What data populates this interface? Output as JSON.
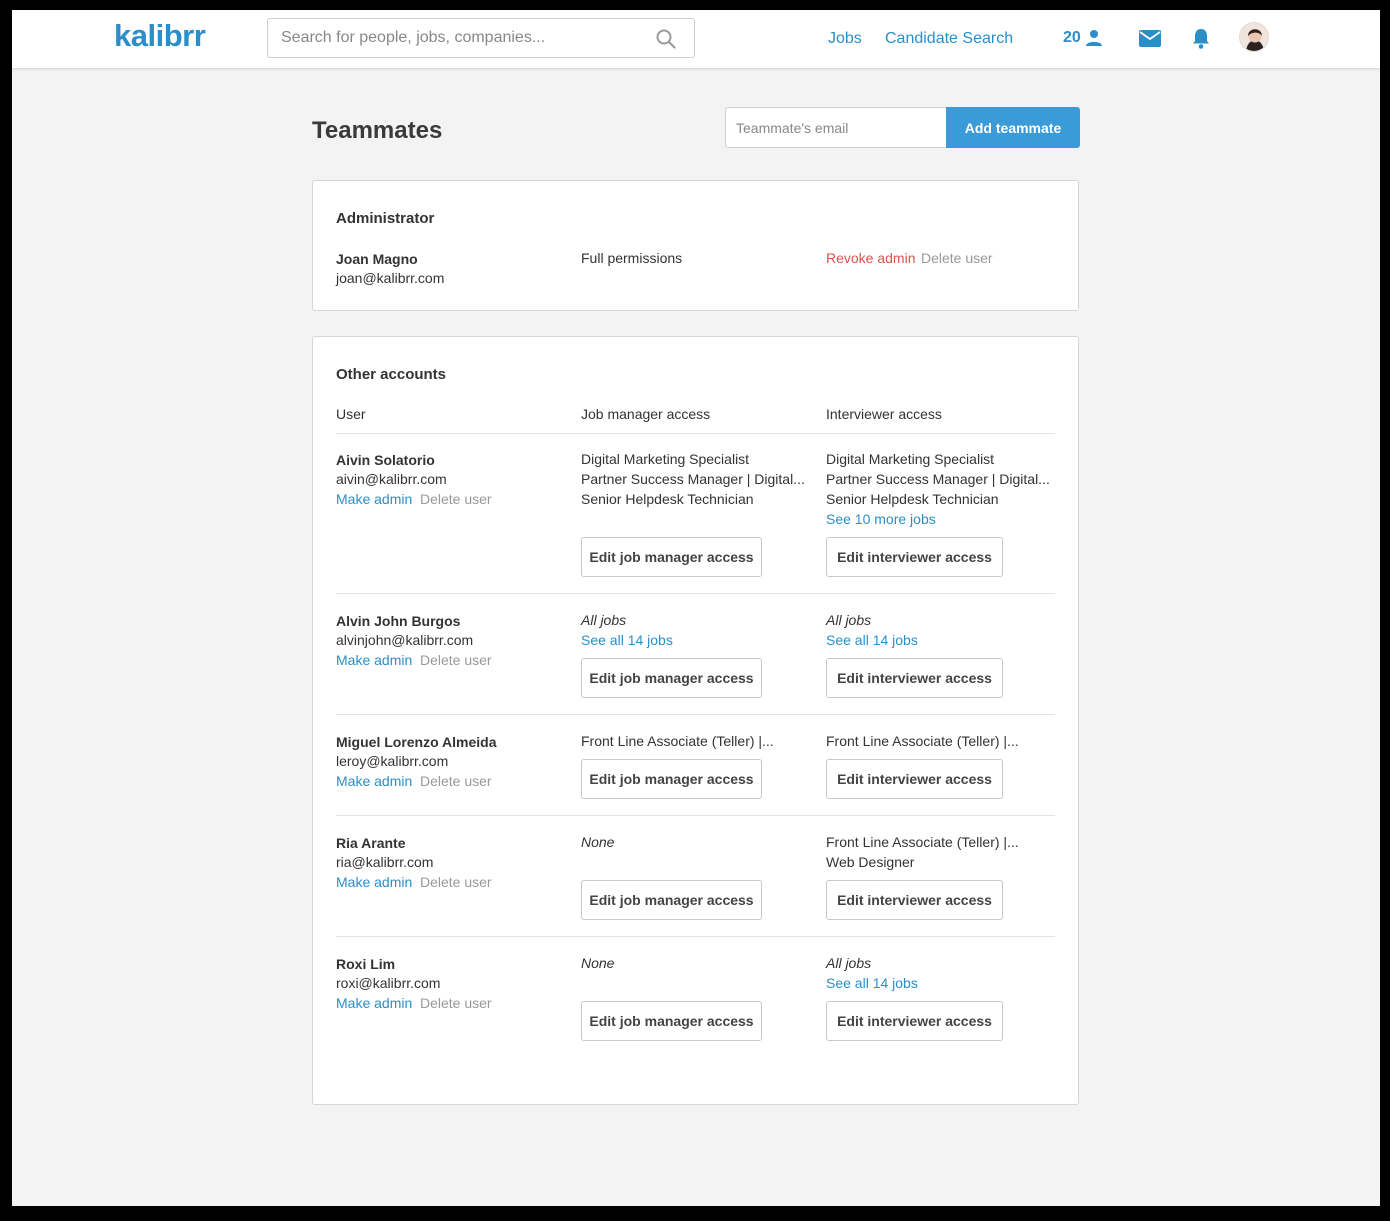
{
  "app": {
    "logo": "kalibrr"
  },
  "search": {
    "placeholder": "Search for people, jobs, companies..."
  },
  "nav": {
    "jobs": "Jobs",
    "candidate_search": "Candidate Search",
    "count": "20"
  },
  "colors": {
    "accent": "#2a8fc9",
    "button": "#3a9bd8",
    "danger": "#d9534f"
  },
  "page": {
    "title": "Teammates",
    "email_placeholder": "Teammate's email",
    "add_button": "Add teammate"
  },
  "admin": {
    "title": "Administrator",
    "name": "Joan Magno",
    "email": "joan@kalibrr.com",
    "permissions": "Full permissions",
    "revoke": "Revoke admin",
    "delete": "Delete user"
  },
  "others": {
    "title": "Other accounts",
    "headers": {
      "user": "User",
      "job_manager": "Job manager access",
      "interviewer": "Interviewer access"
    },
    "make_admin": "Make admin",
    "delete_user": "Delete user",
    "edit_jm": "Edit job manager access",
    "edit_iv": "Edit interviewer access",
    "rows": [
      {
        "name": "Aivin Solatorio",
        "email": "aivin@kalibrr.com",
        "jm": [
          "Digital Marketing Specialist",
          "Partner Success Manager | Digital...",
          "Senior Helpdesk Technician"
        ],
        "iv": [
          "Digital Marketing Specialist",
          "Partner Success Manager | Digital...",
          "Senior Helpdesk Technician"
        ],
        "iv_link": "See 10 more jobs"
      },
      {
        "name": "Alvin John Burgos",
        "email": "alvinjohn@kalibrr.com",
        "jm_all": "All jobs",
        "jm_link": "See all 14 jobs",
        "iv_all": "All jobs",
        "iv_link": "See all 14 jobs"
      },
      {
        "name": "Miguel Lorenzo Almeida",
        "email": "leroy@kalibrr.com",
        "jm": [
          "Front Line Associate (Teller) |..."
        ],
        "iv": [
          "Front Line Associate (Teller) |..."
        ]
      },
      {
        "name": "Ria Arante",
        "email": "ria@kalibrr.com",
        "jm_none": "None",
        "iv": [
          "Front Line Associate (Teller) |...",
          "Web Designer"
        ]
      },
      {
        "name": "Roxi Lim",
        "email": "roxi@kalibrr.com",
        "jm_none": "None",
        "iv_all": "All jobs",
        "iv_link": "See all 14 jobs"
      }
    ]
  }
}
